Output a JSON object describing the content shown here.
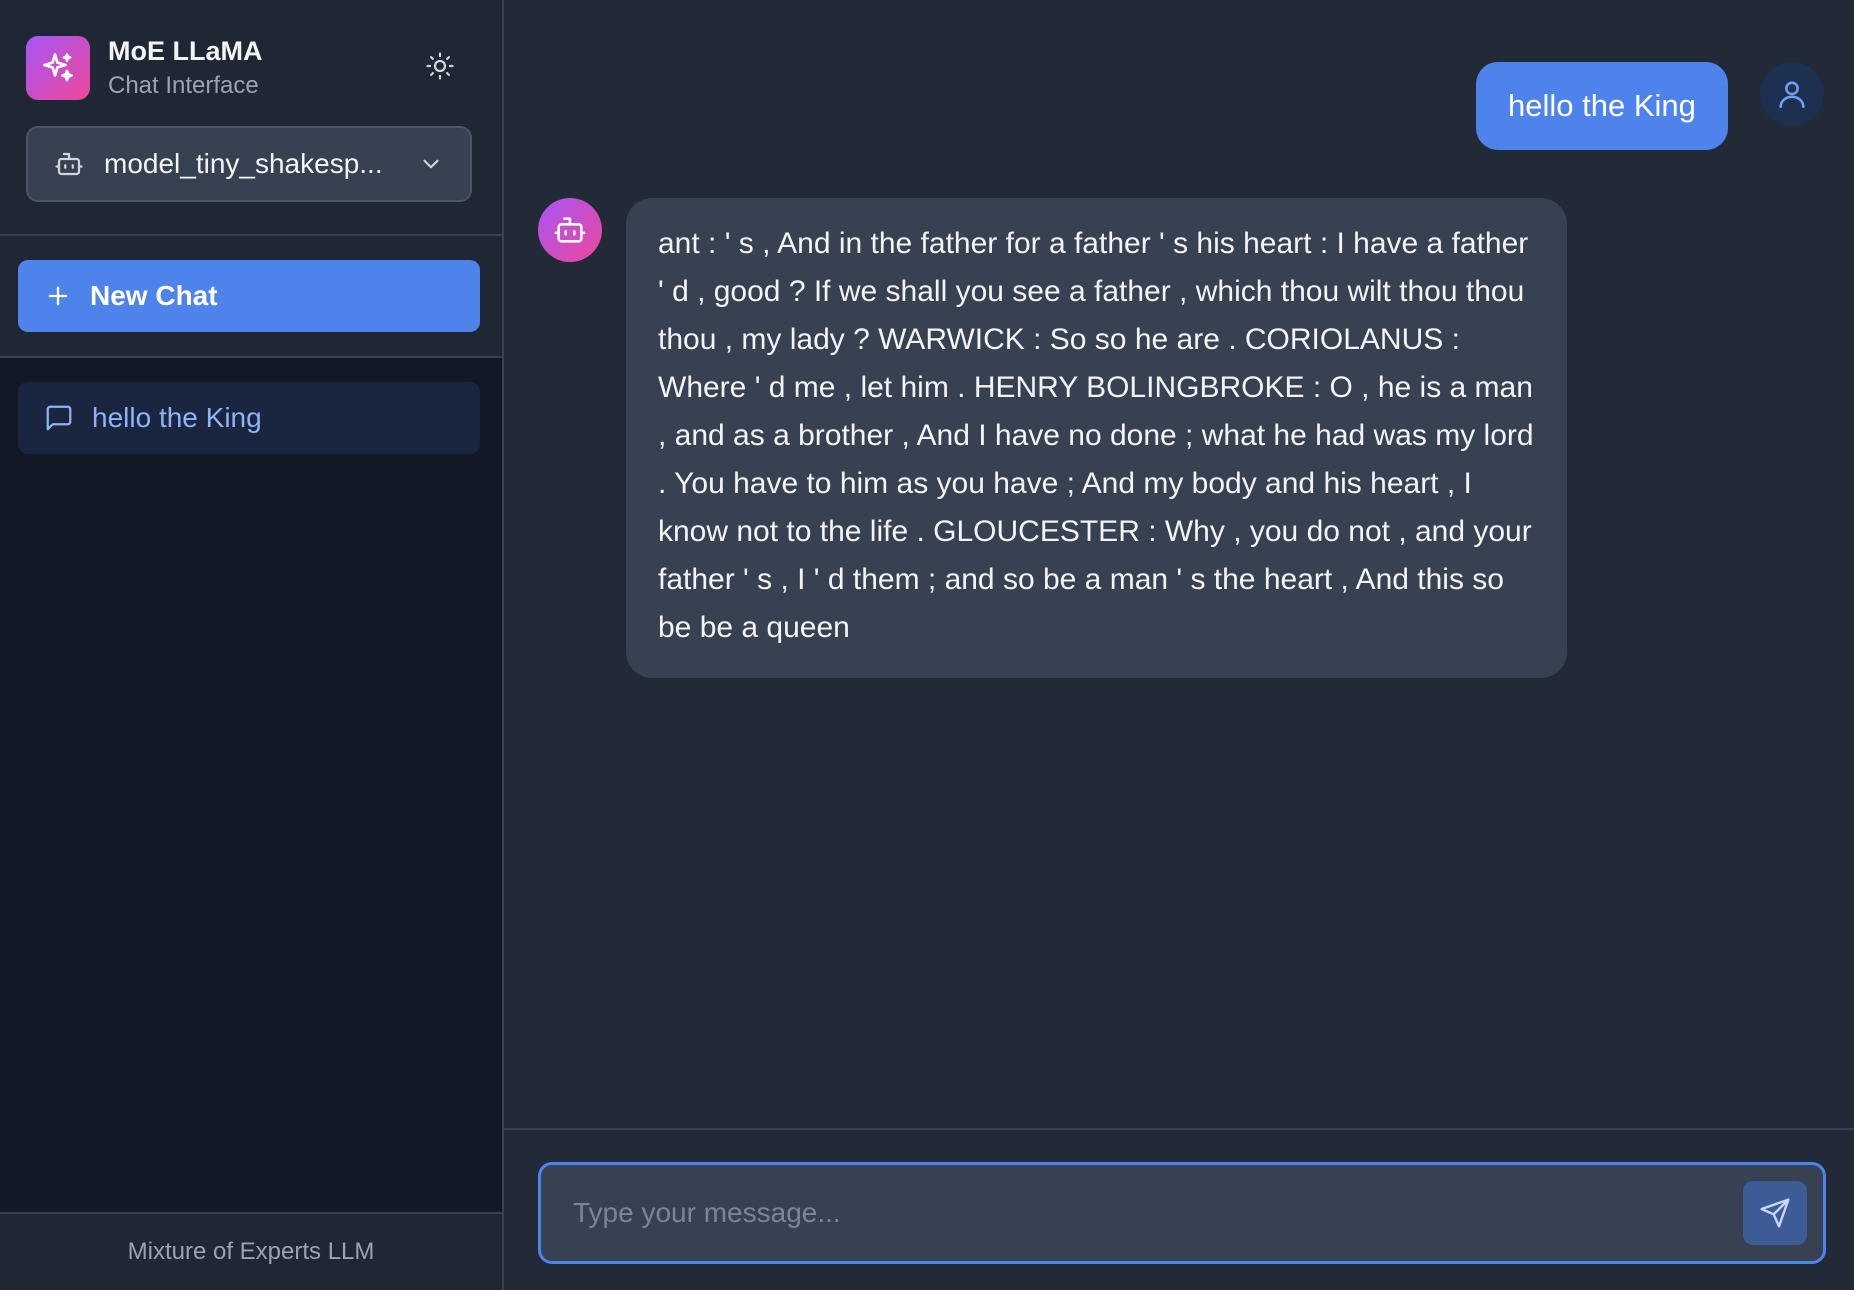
{
  "sidebar": {
    "app_name": "MoE LLaMA",
    "app_subtitle": "Chat Interface",
    "logo_icon": "sparkles-icon",
    "theme_icon": "sun-icon",
    "model_selector": {
      "icon": "bot-icon",
      "selected": "model_tiny_shakesp...",
      "chevron": "chevron-down-icon"
    },
    "new_chat_label": "New Chat",
    "history": [
      {
        "icon": "message-square-icon",
        "label": "hello the King"
      }
    ],
    "footer": "Mixture of Experts LLM"
  },
  "chat": {
    "messages": [
      {
        "role": "user",
        "text": "hello the King"
      },
      {
        "role": "assistant",
        "text": "ant : ' s , And in the father for a father ' s his heart : I have a father ' d , good ? If we shall you see a father , which thou wilt thou thou thou , my lady ? WARWICK : So so he are . CORIOLANUS : Where ' d me , let him . HENRY BOLINGBROKE : O , he is a man , and as a brother , And I have no done ; what he had was my lord . You have to him as you have ; And my body and his heart , I know not to the life . GLOUCESTER : Why , you do not , and your father ' s , I ' d them ; and so be a man ' s the heart , And this so be be a queen"
      }
    ]
  },
  "composer": {
    "placeholder": "Type your message...",
    "value": "",
    "send_icon": "send-icon"
  },
  "colors": {
    "accent": "#4f83ec",
    "sidebar_bg": "#121826",
    "main_bg": "#222937",
    "bubble_bg": "#374151",
    "brand_gradient_start": "#a855f7",
    "brand_gradient_end": "#ec4899"
  }
}
